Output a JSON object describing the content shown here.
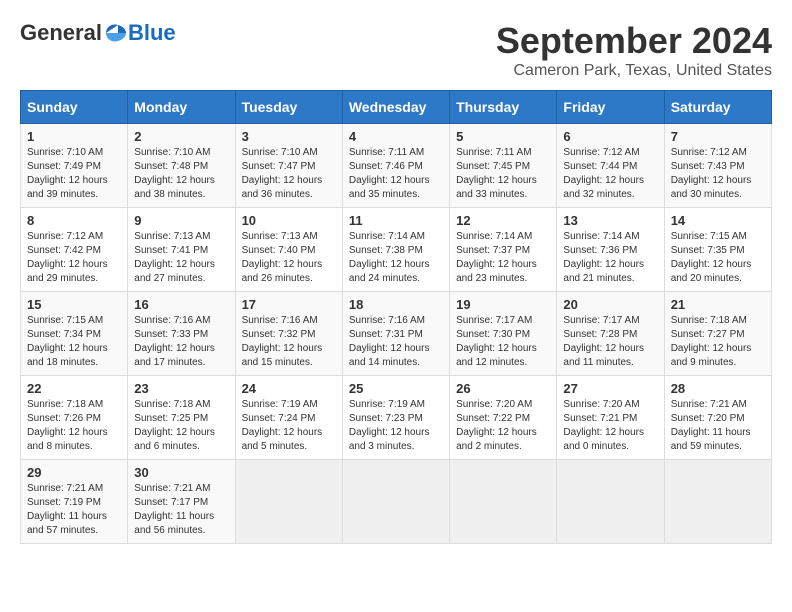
{
  "header": {
    "logo_general": "General",
    "logo_blue": "Blue",
    "month_title": "September 2024",
    "location": "Cameron Park, Texas, United States"
  },
  "weekdays": [
    "Sunday",
    "Monday",
    "Tuesday",
    "Wednesday",
    "Thursday",
    "Friday",
    "Saturday"
  ],
  "weeks": [
    [
      {
        "day": "1",
        "sunrise": "7:10 AM",
        "sunset": "7:49 PM",
        "daylight": "12 hours and 39 minutes."
      },
      {
        "day": "2",
        "sunrise": "7:10 AM",
        "sunset": "7:48 PM",
        "daylight": "12 hours and 38 minutes."
      },
      {
        "day": "3",
        "sunrise": "7:10 AM",
        "sunset": "7:47 PM",
        "daylight": "12 hours and 36 minutes."
      },
      {
        "day": "4",
        "sunrise": "7:11 AM",
        "sunset": "7:46 PM",
        "daylight": "12 hours and 35 minutes."
      },
      {
        "day": "5",
        "sunrise": "7:11 AM",
        "sunset": "7:45 PM",
        "daylight": "12 hours and 33 minutes."
      },
      {
        "day": "6",
        "sunrise": "7:12 AM",
        "sunset": "7:44 PM",
        "daylight": "12 hours and 32 minutes."
      },
      {
        "day": "7",
        "sunrise": "7:12 AM",
        "sunset": "7:43 PM",
        "daylight": "12 hours and 30 minutes."
      }
    ],
    [
      {
        "day": "8",
        "sunrise": "7:12 AM",
        "sunset": "7:42 PM",
        "daylight": "12 hours and 29 minutes."
      },
      {
        "day": "9",
        "sunrise": "7:13 AM",
        "sunset": "7:41 PM",
        "daylight": "12 hours and 27 minutes."
      },
      {
        "day": "10",
        "sunrise": "7:13 AM",
        "sunset": "7:40 PM",
        "daylight": "12 hours and 26 minutes."
      },
      {
        "day": "11",
        "sunrise": "7:14 AM",
        "sunset": "7:38 PM",
        "daylight": "12 hours and 24 minutes."
      },
      {
        "day": "12",
        "sunrise": "7:14 AM",
        "sunset": "7:37 PM",
        "daylight": "12 hours and 23 minutes."
      },
      {
        "day": "13",
        "sunrise": "7:14 AM",
        "sunset": "7:36 PM",
        "daylight": "12 hours and 21 minutes."
      },
      {
        "day": "14",
        "sunrise": "7:15 AM",
        "sunset": "7:35 PM",
        "daylight": "12 hours and 20 minutes."
      }
    ],
    [
      {
        "day": "15",
        "sunrise": "7:15 AM",
        "sunset": "7:34 PM",
        "daylight": "12 hours and 18 minutes."
      },
      {
        "day": "16",
        "sunrise": "7:16 AM",
        "sunset": "7:33 PM",
        "daylight": "12 hours and 17 minutes."
      },
      {
        "day": "17",
        "sunrise": "7:16 AM",
        "sunset": "7:32 PM",
        "daylight": "12 hours and 15 minutes."
      },
      {
        "day": "18",
        "sunrise": "7:16 AM",
        "sunset": "7:31 PM",
        "daylight": "12 hours and 14 minutes."
      },
      {
        "day": "19",
        "sunrise": "7:17 AM",
        "sunset": "7:30 PM",
        "daylight": "12 hours and 12 minutes."
      },
      {
        "day": "20",
        "sunrise": "7:17 AM",
        "sunset": "7:28 PM",
        "daylight": "12 hours and 11 minutes."
      },
      {
        "day": "21",
        "sunrise": "7:18 AM",
        "sunset": "7:27 PM",
        "daylight": "12 hours and 9 minutes."
      }
    ],
    [
      {
        "day": "22",
        "sunrise": "7:18 AM",
        "sunset": "7:26 PM",
        "daylight": "12 hours and 8 minutes."
      },
      {
        "day": "23",
        "sunrise": "7:18 AM",
        "sunset": "7:25 PM",
        "daylight": "12 hours and 6 minutes."
      },
      {
        "day": "24",
        "sunrise": "7:19 AM",
        "sunset": "7:24 PM",
        "daylight": "12 hours and 5 minutes."
      },
      {
        "day": "25",
        "sunrise": "7:19 AM",
        "sunset": "7:23 PM",
        "daylight": "12 hours and 3 minutes."
      },
      {
        "day": "26",
        "sunrise": "7:20 AM",
        "sunset": "7:22 PM",
        "daylight": "12 hours and 2 minutes."
      },
      {
        "day": "27",
        "sunrise": "7:20 AM",
        "sunset": "7:21 PM",
        "daylight": "12 hours and 0 minutes."
      },
      {
        "day": "28",
        "sunrise": "7:21 AM",
        "sunset": "7:20 PM",
        "daylight": "11 hours and 59 minutes."
      }
    ],
    [
      {
        "day": "29",
        "sunrise": "7:21 AM",
        "sunset": "7:19 PM",
        "daylight": "11 hours and 57 minutes."
      },
      {
        "day": "30",
        "sunrise": "7:21 AM",
        "sunset": "7:17 PM",
        "daylight": "11 hours and 56 minutes."
      },
      null,
      null,
      null,
      null,
      null
    ]
  ]
}
